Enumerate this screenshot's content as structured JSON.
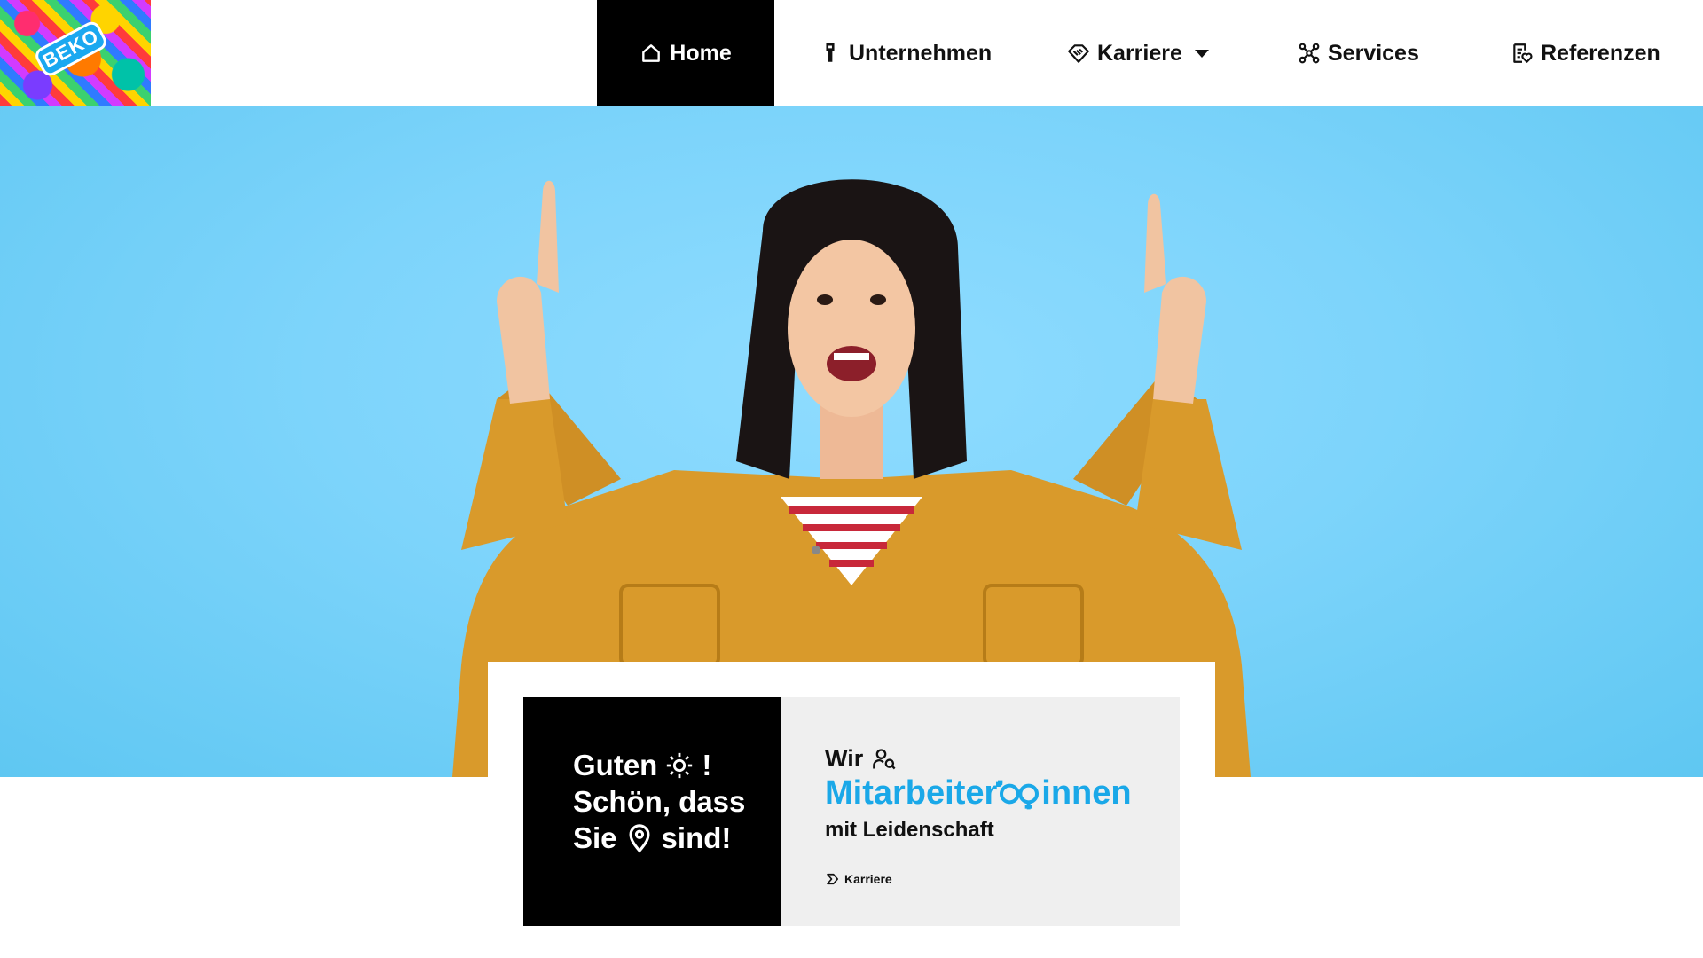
{
  "brand": {
    "logo_text": "BEKO"
  },
  "nav": {
    "home": "Home",
    "unternehmen": "Unternehmen",
    "karriere": "Karriere",
    "services": "Services",
    "referenzen": "Referenzen"
  },
  "hero": {
    "greeting": {
      "line1_start": "Guten",
      "line1_end": "!",
      "line2": "Schön, dass",
      "line3_start": "Sie",
      "line3_end": "sind!"
    },
    "wir": "Wir",
    "mitarbeiter": "Mitarbeiter",
    "innen": "innen",
    "leidenschaft": "mit Leidenschaft",
    "link_label": "Karriere"
  },
  "colors": {
    "accent": "#1aa8e8",
    "hero_bg": "#7dd4fb",
    "nav_active": "#000000"
  },
  "icons": {
    "home": "house-icon",
    "unternehmen": "tower-icon",
    "karriere": "handshake-diamond-icon",
    "services": "network-icon",
    "referenzen": "document-heart-icon",
    "greeting_sun": "sun-icon",
    "location": "map-pin-icon",
    "search_person": "person-search-icon",
    "gender": "gender-icon",
    "arrow": "chevron-right-icon"
  }
}
